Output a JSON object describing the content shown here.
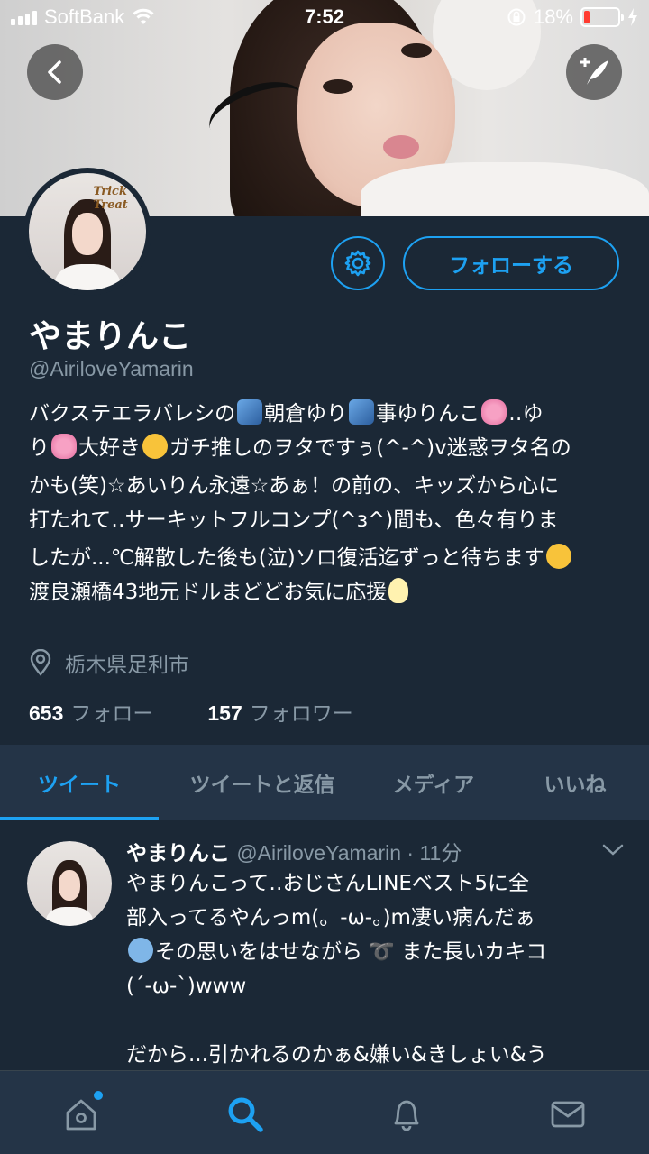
{
  "status_bar": {
    "carrier": "SoftBank",
    "time": "7:52",
    "battery": "18%",
    "battery_level": 0.18
  },
  "profile": {
    "name": "やまりんこ",
    "handle": "@AiriloveYamarin",
    "follow_label": "フォローする",
    "bio_lines": [
      [
        "バクステエラバレシの",
        "star",
        "朝倉ゆり",
        "star",
        "事ゆりんこ",
        "ribbon",
        "‥ゆ"
      ],
      [
        "り",
        "ribbon",
        "大好き",
        "face",
        "ガチ推しのヲタですぅ(^-^)v迷惑ヲタ名の"
      ],
      [
        "かも(笑)☆あいりん永遠☆あぁ！の前の、キッズから心に"
      ],
      [
        "打たれて‥サーキットフルコンプ(^з^)間も、色々有りま"
      ],
      [
        "したが...℃解散した後も(泣)ソロ復活迄ずっと待ちます",
        "face"
      ],
      [
        "渡良瀬橋43地元ドルまどどお気に応援",
        "bulb"
      ]
    ],
    "location": "栃木県足利市",
    "following_count": "653",
    "following_label": "フォロー",
    "followers_count": "157",
    "followers_label": "フォロワー"
  },
  "tabs": [
    {
      "label": "ツイート",
      "active": true
    },
    {
      "label": "ツイートと返信",
      "active": false
    },
    {
      "label": "メディア",
      "active": false
    },
    {
      "label": "いいね",
      "active": false
    }
  ],
  "tweet": {
    "name": "やまりんこ",
    "meta": "@AiriloveYamarin · 11分",
    "lines": [
      "やまりんこって‥おじさんLINEベスト5に全",
      "部入ってるやんっm(。-ω-。)m凄い病んだぁ",
      "その思いをはせながら ➰ また長いカキコ",
      "(´-ω-`)www",
      "",
      "だから...引かれるのかぁ&嫌い&きしょい&う"
    ]
  },
  "avatar_badge": "Trick or Treat",
  "colors": {
    "accent": "#1da1f2",
    "background": "#1b2836",
    "secondary_text": "#8899a6"
  },
  "bottom_nav": [
    "home-icon",
    "search-icon",
    "notifications-icon",
    "messages-icon"
  ]
}
